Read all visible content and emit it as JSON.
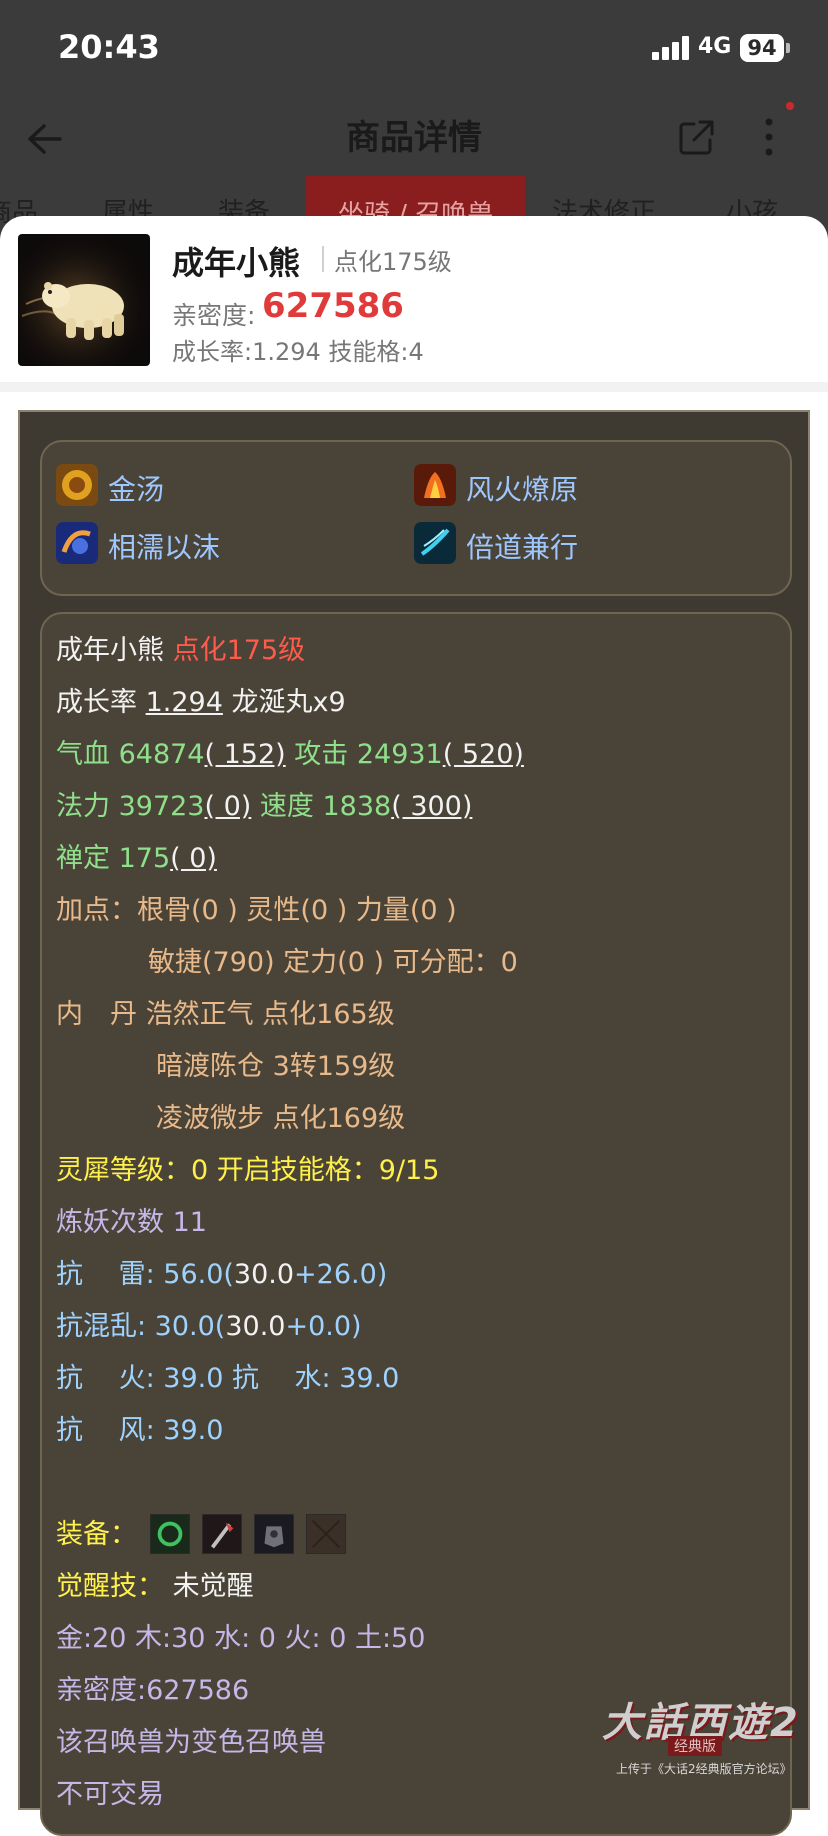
{
  "status_bar": {
    "time": "20:43",
    "network": "4G",
    "battery": "94"
  },
  "nav": {
    "title": "商品详情"
  },
  "tabs": [
    {
      "label": "商品"
    },
    {
      "label": "属性"
    },
    {
      "label": "装备"
    },
    {
      "label": "坐骑 / 召唤兽"
    },
    {
      "label": "法术修正"
    },
    {
      "label": "小孩"
    }
  ],
  "summary": {
    "name": "成年小熊",
    "level": "点化175级",
    "intimacy_label": "亲密度:",
    "intimacy_value": "627586",
    "growth_skill": "成长率:1.294  技能格:4"
  },
  "skills": [
    {
      "name": "金汤",
      "icon": "golden-soup-skill-icon"
    },
    {
      "name": "风火燎原",
      "icon": "wind-fire-skill-icon"
    },
    {
      "name": "相濡以沫",
      "icon": "mutual-care-skill-icon"
    },
    {
      "name": "倍道兼行",
      "icon": "double-speed-skill-icon"
    }
  ],
  "details": {
    "name": "成年小熊",
    "level": "点化175级",
    "growth_label": "成长率",
    "growth_value": "1.294",
    "growth_extra": "龙涎丸x9",
    "hp": "气血 64874",
    "hp_add": "( 152)",
    "atk": "攻击 24931",
    "atk_add": "( 520)",
    "mp": "法力 39723",
    "mp_add": "( 0)",
    "spd": "速度 1838",
    "spd_add": "( 300)",
    "zen": "禅定 175",
    "zen_add": "( 0)",
    "points1": "加点：根骨(0 ) 灵性(0 ) 力量(0 )",
    "points2": "敏捷(790) 定力(0 ) 可分配：0",
    "core1": "内　丹 浩然正气 点化165级",
    "core2": "暗渡陈仓 3转159级",
    "core3": "凌波微步 点化169级",
    "rhino": "灵犀等级：0 开启技能格：9/15",
    "refine": "炼妖次数 11",
    "res_thunder_label": "抗　 雷: 56.0(",
    "res_thunder_base": "30.0",
    "res_thunder_rest": "+26.0)",
    "res_chaos_label": "抗混乱: 30.0(",
    "res_chaos_base": "30.0",
    "res_chaos_rest": "+0.0)",
    "res_fire_water": "抗　 火: 39.0 抗　 水: 39.0",
    "res_wind": "抗　 风: 39.0",
    "equip_label": "装备：",
    "awaken_label": "觉醒技：",
    "awaken_value": "未觉醒",
    "elements": "金:20 木:30 水: 0 火: 0 土:50",
    "intimacy": "亲密度:627586",
    "color_note": "该召唤兽为变色召唤兽",
    "trade_note": "不可交易"
  },
  "equipment_icons": [
    "ring-equip-icon",
    "axe-equip-icon",
    "armor-equip-icon",
    "empty-slot-icon"
  ],
  "watermark": {
    "logo": "大話西遊2",
    "sub": "经典版",
    "caption": "上传于《大话2经典版官方论坛》"
  }
}
